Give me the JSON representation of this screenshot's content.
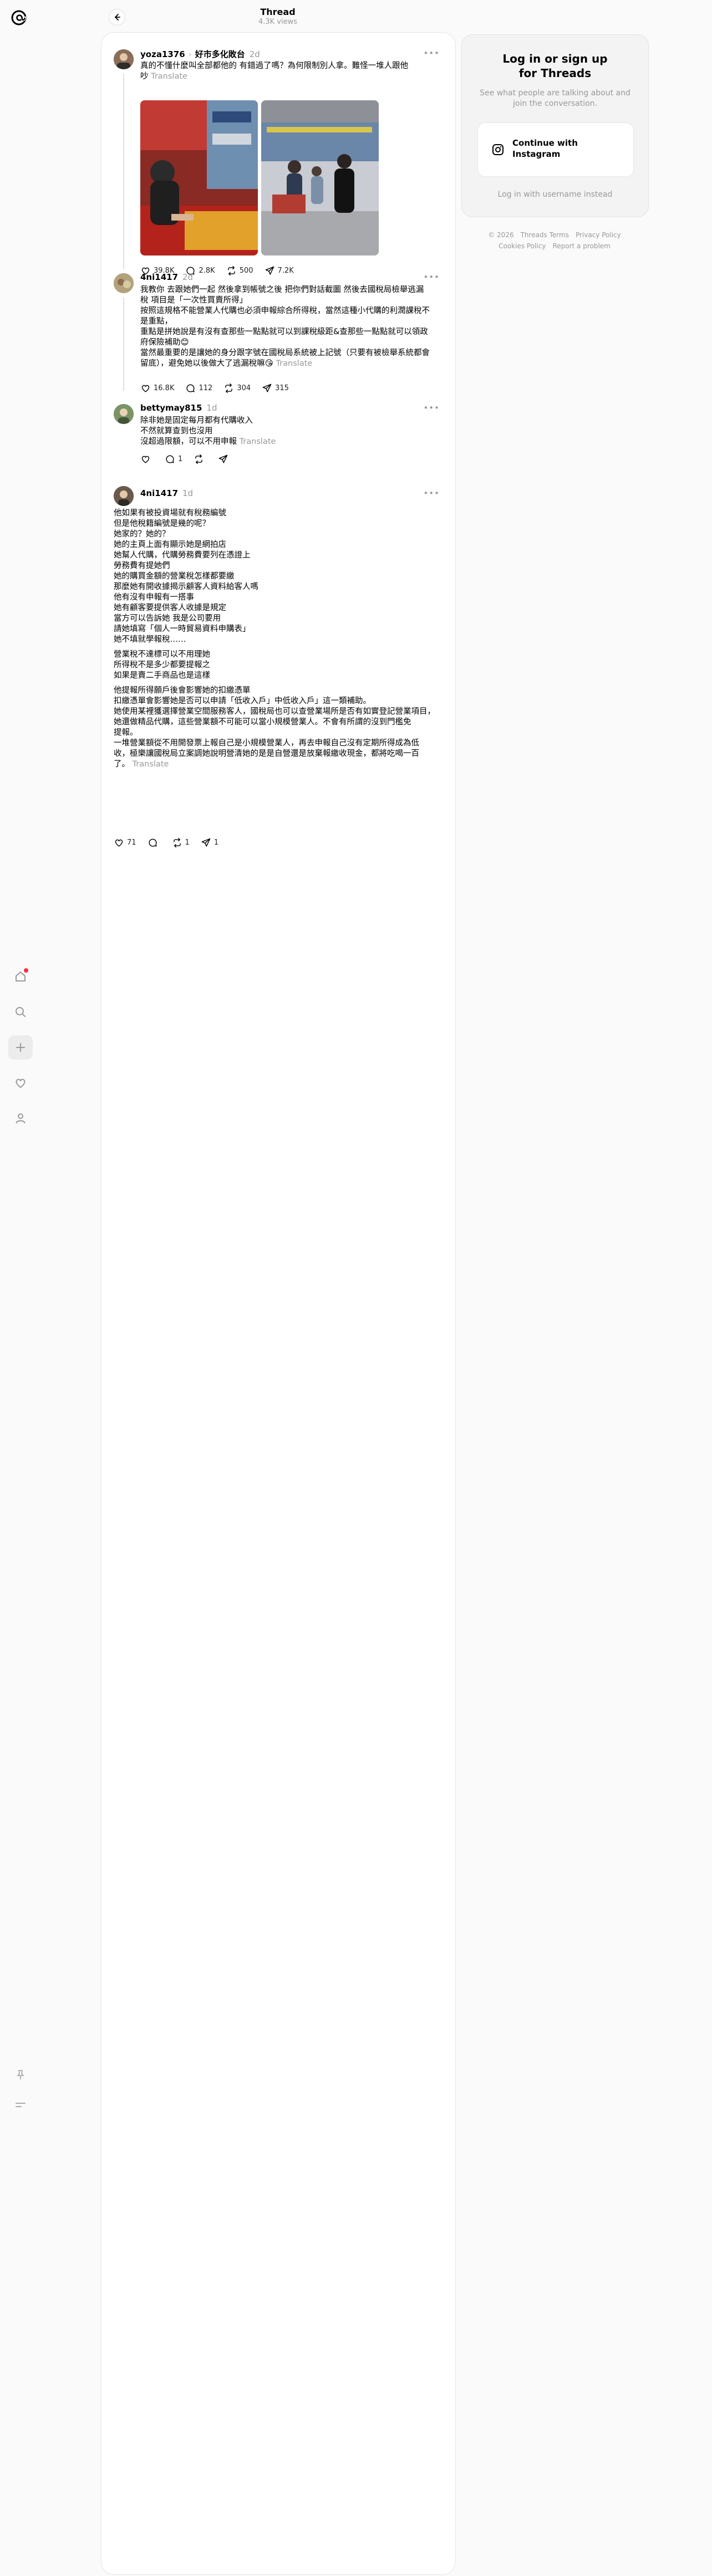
{
  "header": {
    "title": "Thread",
    "views": "4.3K views"
  },
  "posts": [
    {
      "username": "yoza1376",
      "topic": "好市多化敗台",
      "time": "2d",
      "lines": [
        "真的不懂什麼叫全部都他的 有錯過了嗎？為何限制別人拿。難怪一堆人跟他",
        "吵"
      ],
      "translate": "Translate",
      "likes": "39.8K",
      "comments": "2.8K",
      "reposts": "500",
      "shares": "7.2K"
    },
    {
      "username": "4ni1417",
      "time": "2d",
      "lines": [
        "我教你 去跟她們一起 然後拿到帳號之後 把你們對話截圖 然後去國稅局檢舉逃漏",
        "稅 項目是「一次性買賣所得」",
        "按照這規格不能營業人代購也必須申報綜合所得稅，當然這種小代購的利潤課稅不",
        "是重點，",
        "重點是拼她說是有沒有查那些一點點就可以到課稅級距&查那些一點點就可以領政",
        "府保險補助😊",
        "當然最重要的是讓她的身分跟字號在國稅局系統被上記號（只要有被檢舉系統都會",
        "留底），避免她以後做大了逃漏稅嘛😘"
      ],
      "translate": "Translate",
      "likes": "16.8K",
      "comments": "112",
      "reposts": "304",
      "shares": "315"
    },
    {
      "username": "bettymay815",
      "time": "1d",
      "lines": [
        "除非她是固定每月都有代購收入",
        "不然就算查到也沒用",
        "沒超過限額，可以不用申報"
      ],
      "translate": "Translate",
      "comments": "1"
    },
    {
      "username": "4ni1417",
      "time": "1d",
      "para1": [
        "他如果有被投資場就有稅務編號",
        "但是他稅籍編號是幾的呢？",
        "她家的？她的？",
        "她的主頁上面有顯示她是網拍店",
        "她幫人代購，代購勞務費要列在憑證上",
        "勞務費有提她們",
        "她的購買金額的營業稅怎樣都要繳",
        "那麼她有開收據揭示顧客人資料給客人嗎",
        "他有沒有申報有一搭事",
        "她有顧客要提供客人收據是規定",
        "當方可以告訴她 我是公司要用",
        "請她填寫「個人一時貿易資料申購表」",
        "她不填就學報稅……"
      ],
      "para2": [
        "營業稅不達標可以不用理她",
        "所得稅不是多少都要提報之",
        "如果是賣二手商品也是這樣"
      ],
      "para3": [
        "他提報所得願戶後會影響她的扣繳憑單",
        "扣繳憑單會影響她是否可以申請「低收入戶」中低收入戶」這一類補助。",
        "她使用某裡獲選擇營業空間服務客人，國稅局也可以查營業場所是否有如實登記營業項目，",
        "她還做精品代購，這些營業額不可能可以當小規模營業人。不會有所謂的沒到門檻免",
        "提報。",
        "一堆營業額從不用開發票上報自己是小規模營業人，再去申報自己沒有定期所得成為低",
        "收，極樂讓國稅局立案調她說明營清她的是是自營還是放棄報繳收現金，都將吃喝一百",
        "了。"
      ],
      "translate": "Translate",
      "likes": "71",
      "reposts": "1",
      "shares": "1"
    }
  ],
  "login_card": {
    "title_line1": "Log in or sign up",
    "title_line2": "for Threads",
    "subtitle": "See what people are talking about and join the conversation.",
    "button": "Continue with Instagram",
    "alt_link": "Log in with username instead"
  },
  "footer": {
    "copyright": "© 2026",
    "terms": "Threads Terms",
    "privacy": "Privacy Policy",
    "cookies": "Cookies Policy",
    "report": "Report a problem"
  },
  "icons": [
    "threads-logo-icon",
    "back-arrow-icon",
    "home-icon",
    "search-icon",
    "create-icon",
    "heart-icon",
    "profile-icon",
    "pin-icon",
    "menu-icon",
    "like-icon",
    "comment-icon",
    "repost-icon",
    "share-icon",
    "instagram-icon"
  ]
}
